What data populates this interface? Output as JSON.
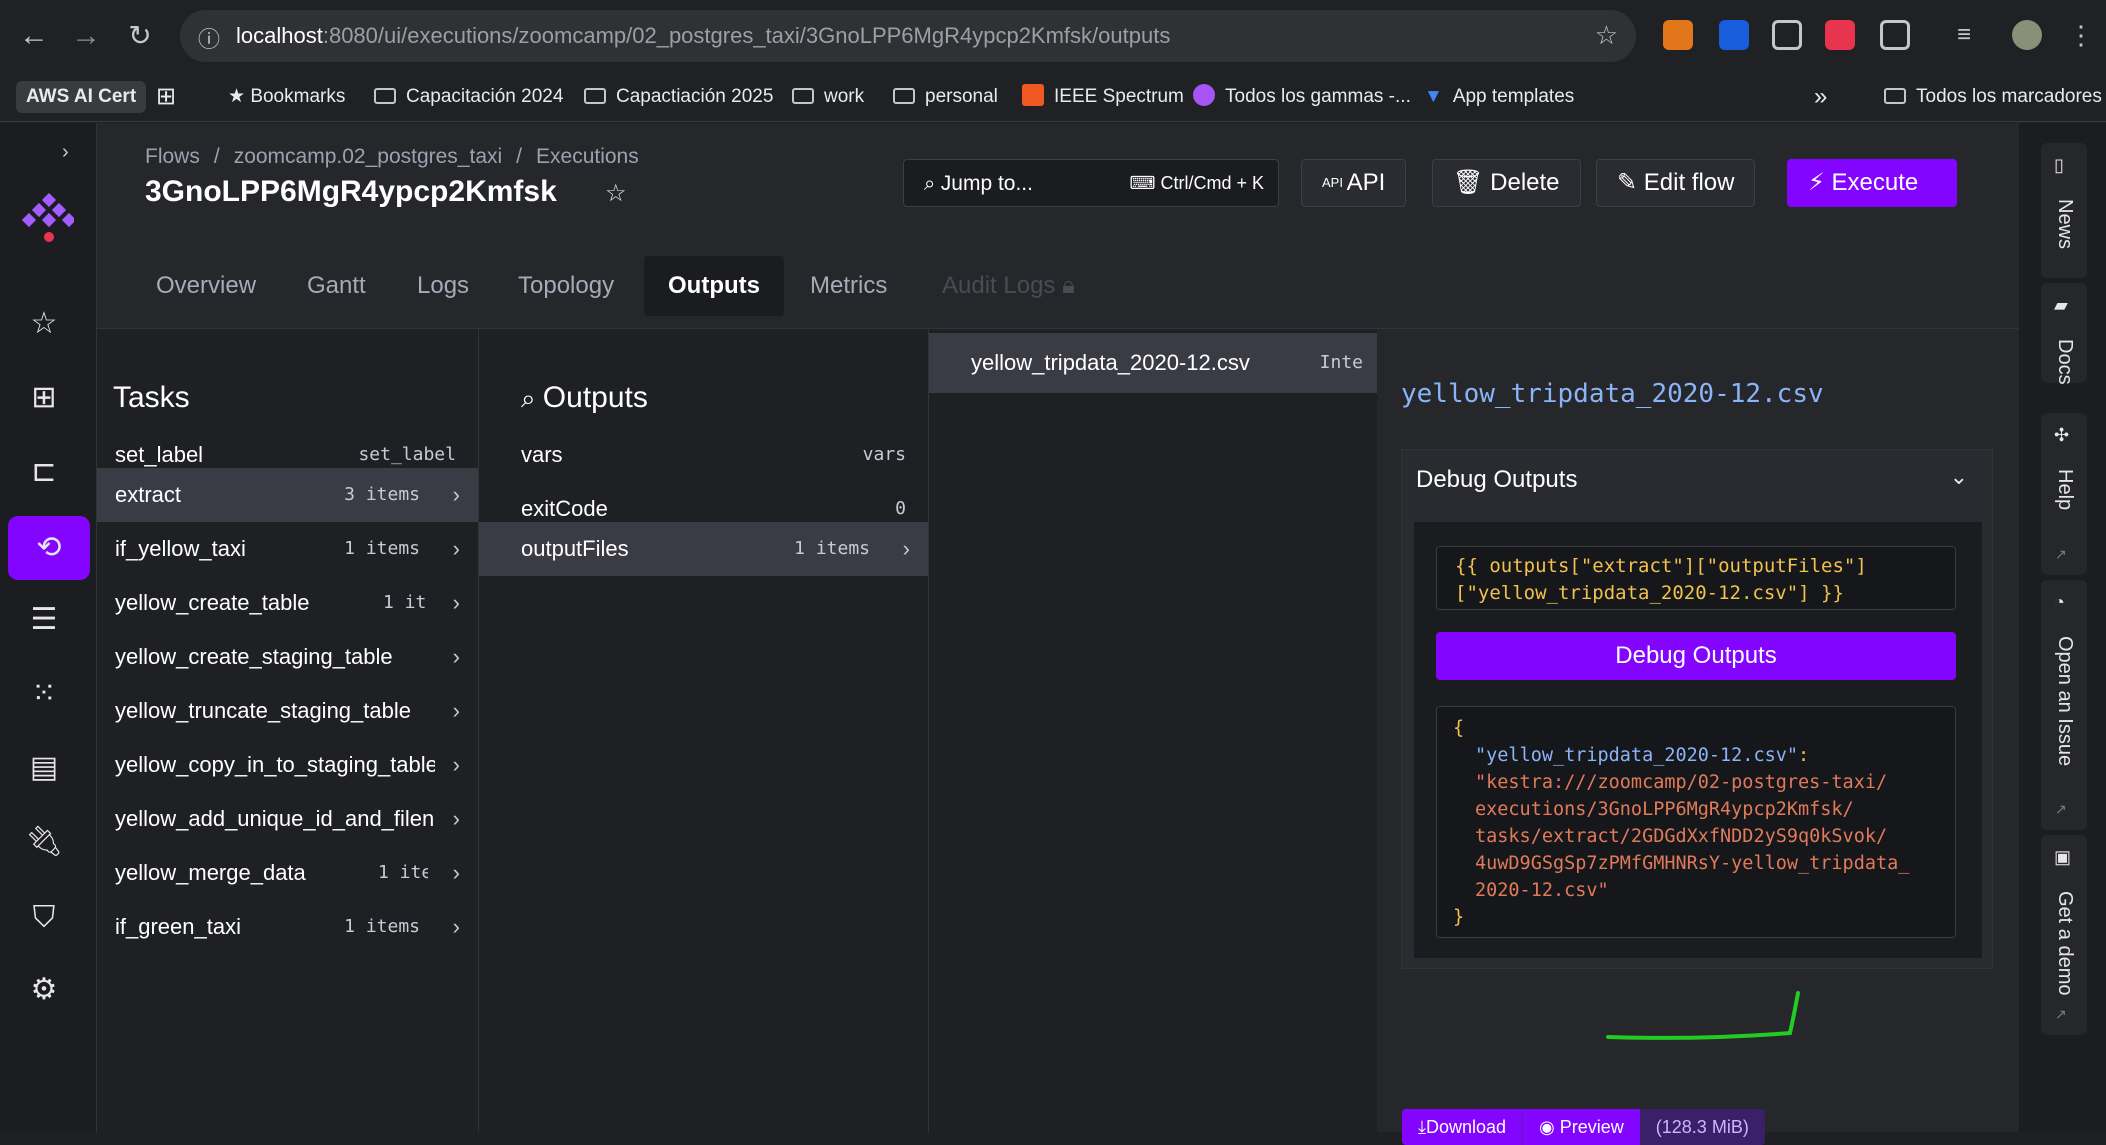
{
  "browser": {
    "url_host": "localhost",
    "url_path": ":8080/ui/executions/zoomcamp/02_postgres_taxi/3GnoLPP6MgR4ypcp2Kmfsk/outputs",
    "profile_label": "AWS AI Cert",
    "bookmarks": [
      "Bookmarks",
      "Capacitación 2024",
      "Capactiación 2025",
      "work",
      "personal",
      "IEEE Spectrum",
      "Todos los gammas -...",
      "App templates"
    ],
    "all_bookmarks": "Todos los marcadores",
    "more": "»"
  },
  "header": {
    "breadcrumb": [
      "Flows",
      "/",
      "zoomcamp.02_postgres_taxi",
      "/",
      "Executions"
    ],
    "title": "3GnoLPP6MgR4ypcp2Kmfsk",
    "jump_label": "Jump to...",
    "jump_shortcut": "Ctrl/Cmd + K",
    "api_label": "API",
    "delete_label": "Delete",
    "edit_label": "Edit flow",
    "execute_label": "Execute"
  },
  "tabs": [
    "Overview",
    "Gantt",
    "Logs",
    "Topology",
    "Outputs",
    "Metrics",
    "Audit Logs"
  ],
  "tasks": {
    "title": "Tasks",
    "items": [
      {
        "label": "set_label",
        "meta": "set_label"
      },
      {
        "label": "extract",
        "meta": "3 items"
      },
      {
        "label": "if_yellow_taxi",
        "meta": "1 items"
      },
      {
        "label": "yellow_create_table",
        "meta": "1 ite"
      },
      {
        "label": "yellow_create_staging_table",
        "meta": ""
      },
      {
        "label": "yellow_truncate_staging_table",
        "meta": ""
      },
      {
        "label": "yellow_copy_in_to_staging_table",
        "meta": ""
      },
      {
        "label": "yellow_add_unique_id_and_filen",
        "meta": ""
      },
      {
        "label": "yellow_merge_data",
        "meta": "1 ite"
      },
      {
        "label": "if_green_taxi",
        "meta": "1 items"
      }
    ]
  },
  "outputs": {
    "title": "Outputs",
    "items": [
      {
        "label": "vars",
        "meta": "vars"
      },
      {
        "label": "exitCode",
        "meta": "0"
      },
      {
        "label": "outputFiles",
        "meta": "1 items"
      }
    ]
  },
  "files": {
    "items": [
      {
        "label": "yellow_tripdata_2020-12.csv",
        "meta": "Inte"
      }
    ]
  },
  "detail": {
    "file_title": "yellow_tripdata_2020-12.csv",
    "debug_heading": "Debug Outputs",
    "expression_line1": "{{ outputs[\"extract\"][\"outputFiles\"]",
    "expression_line2": "[\"yellow_tripdata_2020-12.csv\"] }}",
    "debug_button": "Debug Outputs",
    "result_open": "{",
    "result_key": "\"yellow_tripdata_2020-12.csv\"",
    "result_colon": ":",
    "result_value_lines": [
      "\"kestra:///zoomcamp/02-postgres-taxi/",
      "executions/3GnoLPP6MgR4ypcp2Kmfsk/",
      "tasks/extract/2GDGdXxfNDD2yS9q0kSvok/",
      "4uwD9GSgSp7zPMfGMHNRsY-yellow_tripdata_",
      "2020-12.csv\""
    ],
    "result_close": "}",
    "download_label": "Download",
    "preview_label": "Preview",
    "size_label": "(128.3 MiB)"
  },
  "right_rail": [
    "News",
    "Docs",
    "Help",
    "Open an Issue",
    "Get a demo"
  ],
  "colors": {
    "accent": "#8405ff",
    "annotation": "#22cc22"
  }
}
